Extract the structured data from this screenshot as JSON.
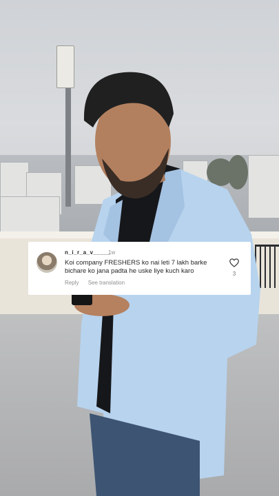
{
  "comment": {
    "username": "n_i_r_a_v_____",
    "time": "1w",
    "text": "Koi company FRESHERS ko nai leti 7 lakh barke bichare ko jana padta he  uske liye kuch karo",
    "reply_label": "Reply",
    "translation_label": "See translation",
    "like_count": "3",
    "heart_icon": "heart-outline-icon",
    "avatar_icon": "user-avatar"
  },
  "colors": {
    "card_bg": "#ffffff",
    "text_primary": "#262626",
    "text_secondary": "#8e8e8e"
  }
}
